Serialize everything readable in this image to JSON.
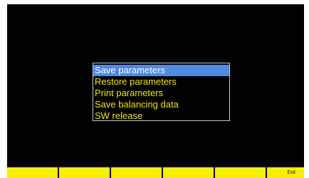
{
  "menu": {
    "items": [
      {
        "label": "Save parameters",
        "selected": true
      },
      {
        "label": "Restore parameters",
        "selected": false
      },
      {
        "label": "Print parameters",
        "selected": false
      },
      {
        "label": "Save balancing data",
        "selected": false
      },
      {
        "label": "SW release",
        "selected": false
      }
    ]
  },
  "softkeys": {
    "f1": "",
    "f2": "",
    "f3": "",
    "f4": "",
    "f5": "",
    "f6": "Exit"
  },
  "colors": {
    "background": "#000000",
    "menu_text": "#f2e600",
    "selection": "#4f8be0",
    "softkey": "#f7ee00"
  }
}
